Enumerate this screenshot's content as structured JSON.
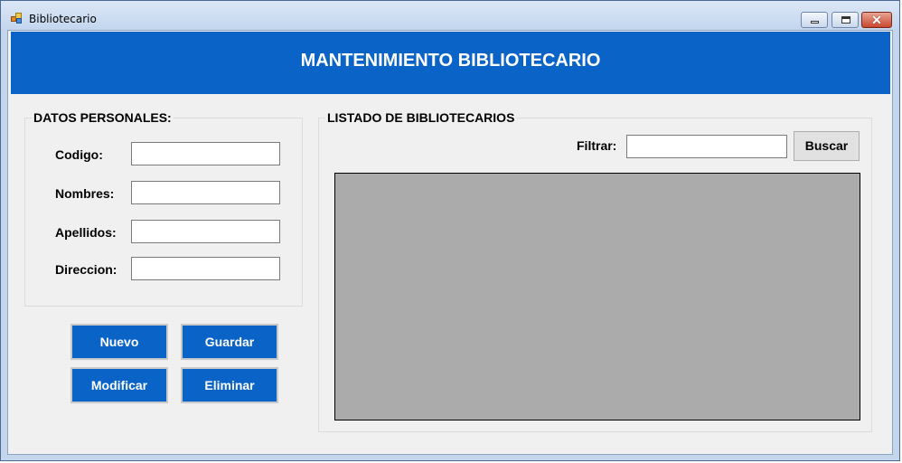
{
  "window": {
    "title": "Bibliotecario"
  },
  "header": {
    "title": "MANTENIMIENTO BIBLIOTECARIO"
  },
  "personal": {
    "title": "DATOS PERSONALES:",
    "codigo_label": "Codigo:",
    "nombres_label": "Nombres:",
    "apellidos_label": "Apellidos:",
    "direccion_label": "Direccion:",
    "codigo_value": "",
    "nombres_value": "",
    "apellidos_value": "",
    "direccion_value": ""
  },
  "actions": {
    "nuevo": "Nuevo",
    "guardar": "Guardar",
    "modificar": "Modificar",
    "eliminar": "Eliminar"
  },
  "listing": {
    "title": "LISTADO DE BIBLIOTECARIOS",
    "filter_label": "Filtrar:",
    "filter_value": "",
    "search_button": "Buscar"
  },
  "colors": {
    "accent": "#0a64c8",
    "grid_bg": "#ababab",
    "form_bg": "#f0f0f0"
  },
  "icons": {
    "app": "form-app-icon",
    "minimize": "minimize-icon",
    "maximize": "maximize-icon",
    "close": "close-icon"
  }
}
